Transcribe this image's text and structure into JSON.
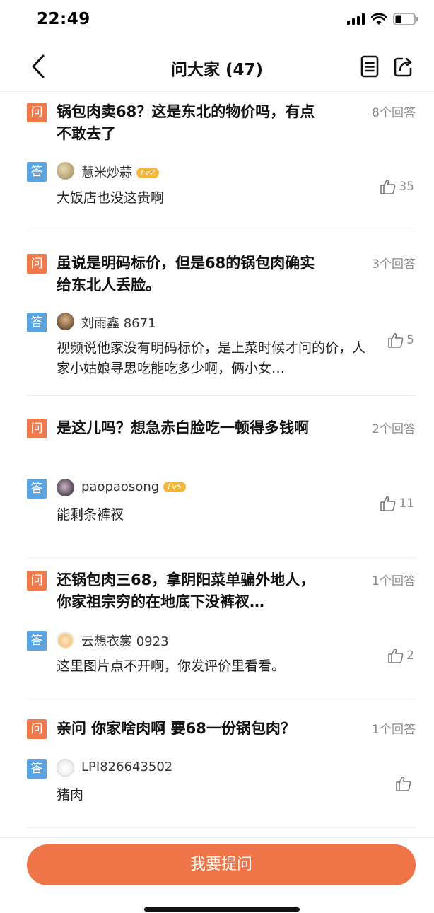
{
  "status_bar": {
    "time": "22:49"
  },
  "header": {
    "title": "问大家 (47)"
  },
  "labels": {
    "question": "问",
    "answer": "答"
  },
  "questions": [
    {
      "question": "锅包肉卖68？这是东北的物价吗，有点不敢去了",
      "answer_count": "8个回答",
      "answer": {
        "username": "慧米炒蒜",
        "level": "Lv2",
        "text": "大饭店也没这贵啊",
        "likes": "35"
      }
    },
    {
      "question": "虽说是明码标价，但是68的锅包肉确实给东北人丢脸。",
      "answer_count": "3个回答",
      "answer": {
        "username": "刘雨鑫 8671",
        "level": "",
        "text": "视频说他家没有明码标价，是上菜时候才问的价，人家小姑娘寻思吃能吃多少啊，俩小女…",
        "likes": "5"
      }
    },
    {
      "question": "是这儿吗？想急赤白脸吃一顿得多钱啊",
      "answer_count": "2个回答",
      "answer": {
        "username": "paopaosong",
        "level": "Lv5",
        "text": "能剩条裤衩",
        "likes": "11"
      }
    },
    {
      "question": "还锅包肉三68，拿阴阳菜单骗外地人，你家祖宗穷的在地底下没裤衩…",
      "answer_count": "1个回答",
      "answer": {
        "username": "云想衣裳 0923",
        "level": "",
        "text": "这里图片点不开啊，你发评价里看看。",
        "likes": "2"
      }
    },
    {
      "question": "亲问 你家啥肉啊 要68一份锅包肉？",
      "answer_count": "1个回答",
      "answer": {
        "username": "LPI826643502",
        "level": "",
        "text": "猪肉",
        "likes": ""
      }
    }
  ],
  "ask_button": {
    "label": "我要提问"
  },
  "colors": {
    "accent": "#ef7448",
    "question_badge": "#f07a4b",
    "answer_badge": "#5ba4df",
    "level_badge": "#f4b63c"
  }
}
